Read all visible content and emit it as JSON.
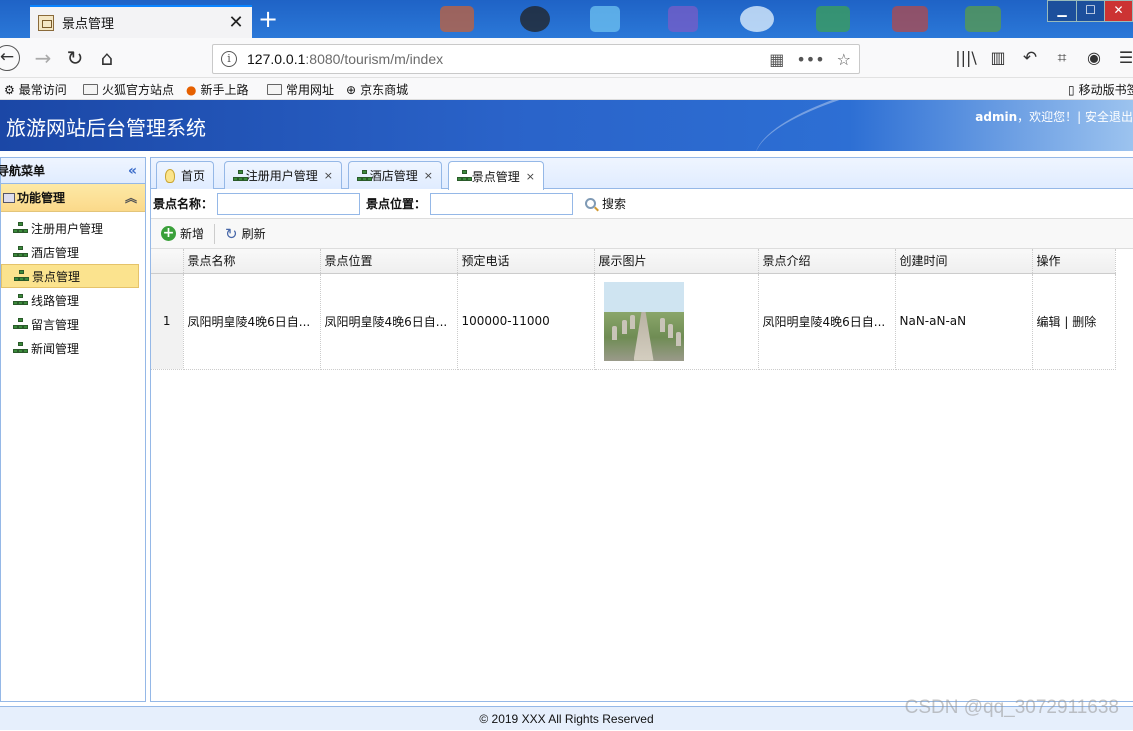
{
  "browser": {
    "tab_title": "景点管理",
    "url_host": "127.0.0.1",
    "url_rest": ":8080/tourism/m/index",
    "more_label": "•••",
    "bookmarks": [
      "最常访问",
      "火狐官方站点",
      "新手上路",
      "常用网址",
      "京东商城",
      "移动版书签"
    ]
  },
  "app": {
    "title": "旅游网站后台管理系统",
    "user": "admin",
    "welcome": "，欢迎您！| 安全退出"
  },
  "sidebar": {
    "heading": "导航菜单",
    "section": "功能管理",
    "items": [
      "注册用户管理",
      "酒店管理",
      "景点管理",
      "线路管理",
      "留言管理",
      "新闻管理"
    ],
    "active_index": 2
  },
  "tabs": [
    "首页",
    "注册用户管理",
    "酒店管理",
    "景点管理"
  ],
  "tab_close": "×",
  "search": {
    "name_label": "景点名称：",
    "name_value": "",
    "location_label": "景点位置：",
    "location_value": "",
    "button": "搜索"
  },
  "toolbar": {
    "add": "新增",
    "refresh": "刷新"
  },
  "table": {
    "columns": [
      "景点名称",
      "景点位置",
      "预定电话",
      "展示图片",
      "景点介绍",
      "创建时间",
      "操作"
    ],
    "rows": [
      {
        "index": "1",
        "name": "凤阳明皇陵4晚6日自...",
        "location": "凤阳明皇陵4晚6日自...",
        "phone": "100000-11000",
        "intro": "凤阳明皇陵4晚6日自...",
        "created": "NaN-aN-aN",
        "edit": "编辑",
        "sep": " | ",
        "delete": "删除"
      }
    ]
  },
  "footer": "© 2019 XXX All Rights Reserved",
  "watermark": "CSDN @qq_3072911638"
}
